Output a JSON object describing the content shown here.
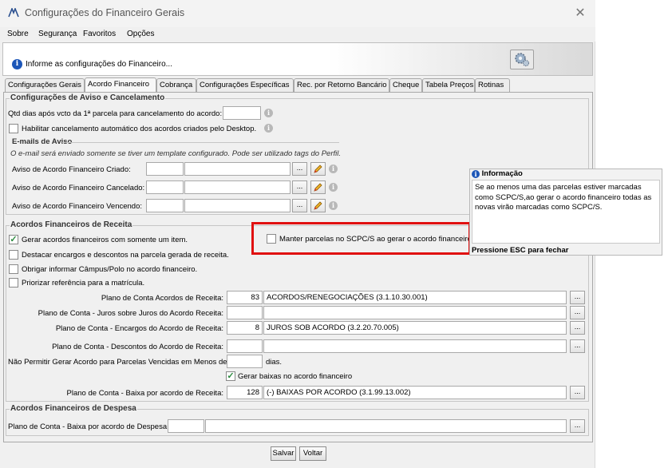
{
  "window": {
    "title": "Configurações do Financeiro Gerais",
    "close_glyph": "✕",
    "logo": "app-logo-icon"
  },
  "menu": [
    "Sobre",
    "Segurança",
    "Favoritos",
    "Opções"
  ],
  "infobar": {
    "text": "Informe as configurações do Financeiro..."
  },
  "tabs": [
    "Configurações Gerais",
    "Acordo Financeiro",
    "Cobrança",
    "Configurações Específicas",
    "Rec. por Retorno Bancário",
    "Cheque",
    "Tabela Preços",
    "Rotinas"
  ],
  "active_tab": "Acordo Financeiro",
  "aviso": {
    "title": "Configurações de Aviso e Cancelamento",
    "qtd_label": "Qtd dias após vcto da 1ª parcela para cancelamento do acordo:",
    "qtd_value": "",
    "habilitar_label": "Habilitar cancelamento automático dos acordos criados pelo Desktop.",
    "emails_title": "E-mails de Aviso",
    "emails_note": "O e-mail será enviado somente se tiver um template configurado. Pode ser utilizado tags do Perfil.",
    "rows": [
      {
        "label": "Aviso de Acordo Financeiro Criado:",
        "code": "",
        "desc": ""
      },
      {
        "label": "Aviso de Acordo Financeiro Cancelado:",
        "code": "",
        "desc": ""
      },
      {
        "label": "Aviso de Acordo Financeiro Vencendo:",
        "code": "",
        "desc": ""
      }
    ],
    "dots": "..."
  },
  "receita": {
    "title": "Acordos Financeiros de Receita",
    "checks": [
      {
        "label": "Gerar acordos financeiros com somente um item.",
        "checked": true
      },
      {
        "label": "Destacar encargos e descontos na parcela gerada de receita.",
        "checked": false
      },
      {
        "label": "Obrigar informar Câmpus/Polo no acordo financeiro.",
        "checked": false
      },
      {
        "label": "Priorizar referência para a matrícula.",
        "checked": false
      }
    ],
    "manter_label": "Manter parcelas no SCPC/S ao gerar o acordo financeiro.",
    "manter_checked": false,
    "plans": [
      {
        "label": "Plano de Conta Acordos de Receita:",
        "code": "83",
        "desc": "ACORDOS/RENEGOCIAÇÕES (3.1.10.30.001)"
      },
      {
        "label": "Plano de Conta - Juros sobre Juros do Acordo Receita:",
        "code": "",
        "desc": ""
      },
      {
        "label": "Plano de Conta - Encargos do Acordo de Receita:",
        "code": "8",
        "desc": "JUROS SOB ACORDO (3.2.20.70.005)"
      },
      {
        "label": "Plano de Conta - Descontos do Acordo de Receita:",
        "code": "",
        "desc": ""
      }
    ],
    "nao_permitir_label": "Não Permitir Gerar Acordo para Parcelas Vencidas em Menos de",
    "nao_permitir_value": "",
    "dias_label": "dias.",
    "gerar_baixas_label": "Gerar baixas no acordo financeiro",
    "gerar_baixas_checked": true,
    "baixa_label": "Plano de Conta - Baixa por acordo de Receita:",
    "baixa_code": "128",
    "baixa_desc": "(-) BAIXAS POR ACORDO (3.1.99.13.002)"
  },
  "despesa": {
    "title": "Acordos Financeiros de Despesa",
    "label": "Plano de Conta - Baixa por acordo de Despesa:",
    "code": "",
    "desc": ""
  },
  "popup": {
    "title": "Informação",
    "body": "Se ao menos uma das parcelas estiver marcadas como SCPC/S,ao gerar o acordo financeiro todas as novas virão marcadas como SCPC/S.",
    "footer": "Pressione ESC para fechar"
  },
  "buttons": {
    "save": "Salvar",
    "back": "Voltar"
  },
  "colors": {
    "highlight": "#e01010",
    "info_blue": "#1c56b8",
    "check_green": "#2b8a3e"
  }
}
